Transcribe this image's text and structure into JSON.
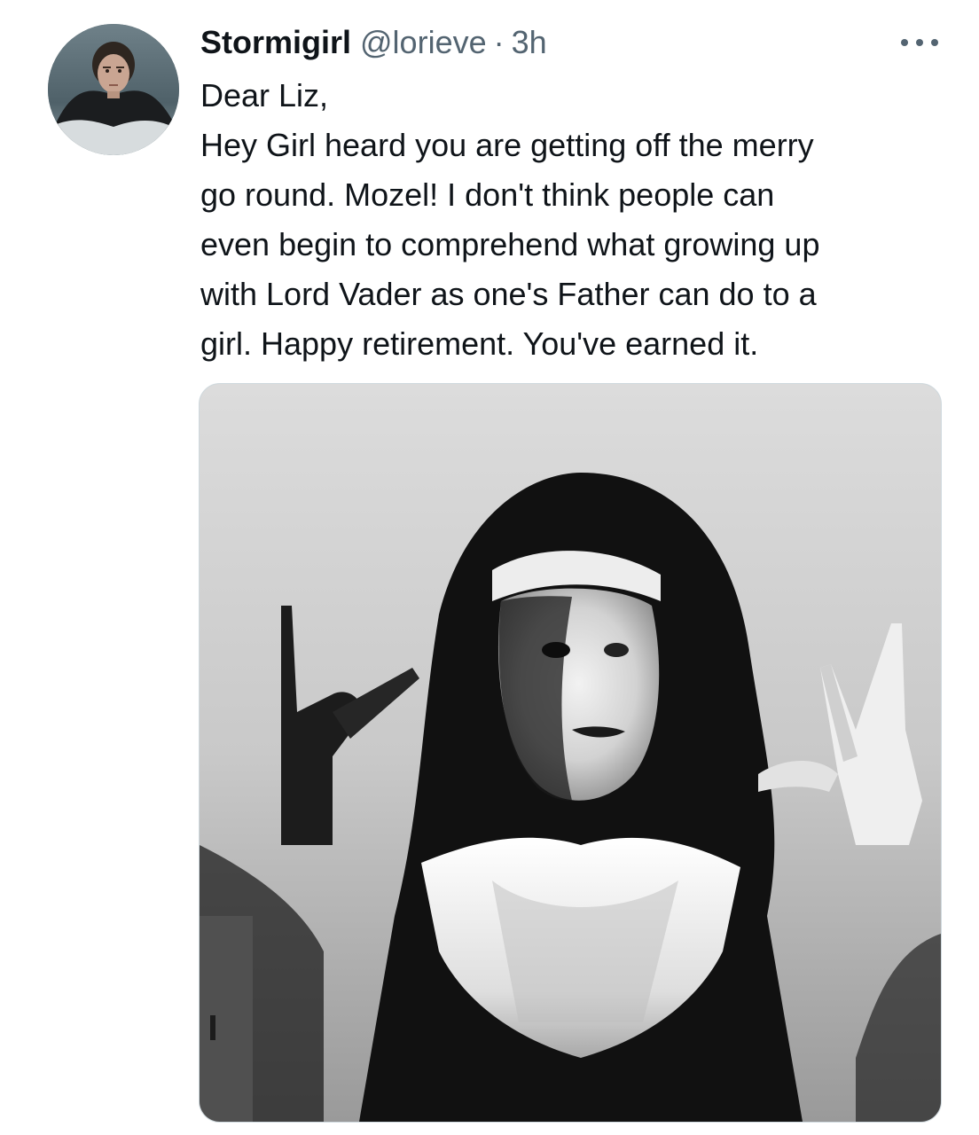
{
  "tweet": {
    "display_name": "Stormigirl",
    "handle": "@lorieve",
    "separator": "·",
    "time": "3h",
    "more_icon": "more-horizontal-icon",
    "text_lines": [
      "Dear Liz,",
      "Hey Girl heard you are getting off the merry",
      "go round. Mozel! I don't think people can",
      "even begin to comprehend what growing up",
      "with Lord Vader as one's Father can do to a",
      "girl. Happy retirement. You've earned it."
    ]
  },
  "colors": {
    "text_primary": "#0f1419",
    "text_secondary": "#536471",
    "border": "#cfd9de",
    "background": "#ffffff"
  }
}
